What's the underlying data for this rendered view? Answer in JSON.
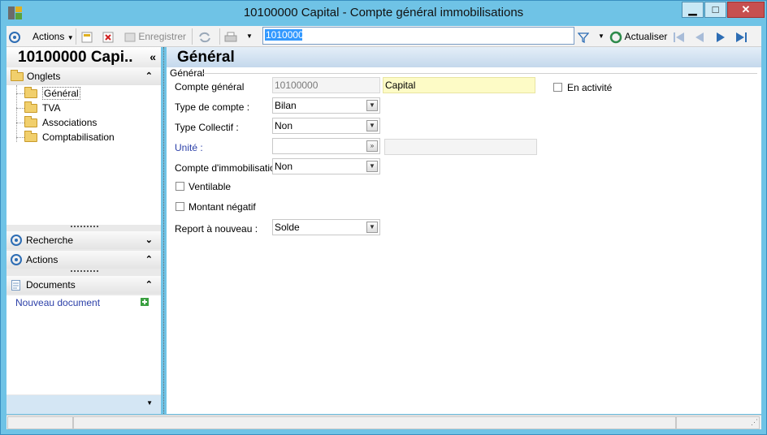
{
  "window": {
    "title": "10100000 Capital -  Compte général immobilisations",
    "controls": {
      "minimize": "▁",
      "maximize": "□",
      "close": "✕"
    },
    "accent": "#6fc3e6"
  },
  "toolbar": {
    "actions_label": "Actions",
    "save_label": "Enregistrer",
    "search_value": "10100000",
    "refresh_label": "Actualiser"
  },
  "sidebar": {
    "record_title": "10100000 Capi..",
    "collapse_glyph": "«",
    "onglets": {
      "label": "Onglets",
      "chevron": "⌃",
      "items": [
        {
          "label": "Général",
          "selected": true
        },
        {
          "label": "TVA"
        },
        {
          "label": "Associations"
        },
        {
          "label": "Comptabilisation"
        }
      ]
    },
    "recherche": {
      "label": "Recherche",
      "chevron": "⌄"
    },
    "actions": {
      "label": "Actions",
      "chevron": "⌃"
    },
    "documents": {
      "label": "Documents",
      "chevron": "⌃",
      "new_document": "Nouveau document"
    }
  },
  "main": {
    "title": "Général",
    "group_label": "Général",
    "fields": {
      "compte_general": {
        "label": "Compte général",
        "code": "10100000",
        "name": "Capital"
      },
      "type_compte": {
        "label": "Type de compte :",
        "value": "Bilan"
      },
      "type_collectif": {
        "label": "Type Collectif :",
        "value": "Non"
      },
      "unite": {
        "label": "Unité :",
        "value": "",
        "extra": ""
      },
      "compte_immo": {
        "label": "Compte d'immobilisation :",
        "value": "Non"
      },
      "ventilable": {
        "label": "Ventilable",
        "checked": false
      },
      "montant_negatif": {
        "label": "Montant négatif",
        "checked": false
      },
      "report": {
        "label": "Report à nouveau :",
        "value": "Solde"
      },
      "en_activite": {
        "label": "En activité",
        "checked": false
      }
    }
  }
}
